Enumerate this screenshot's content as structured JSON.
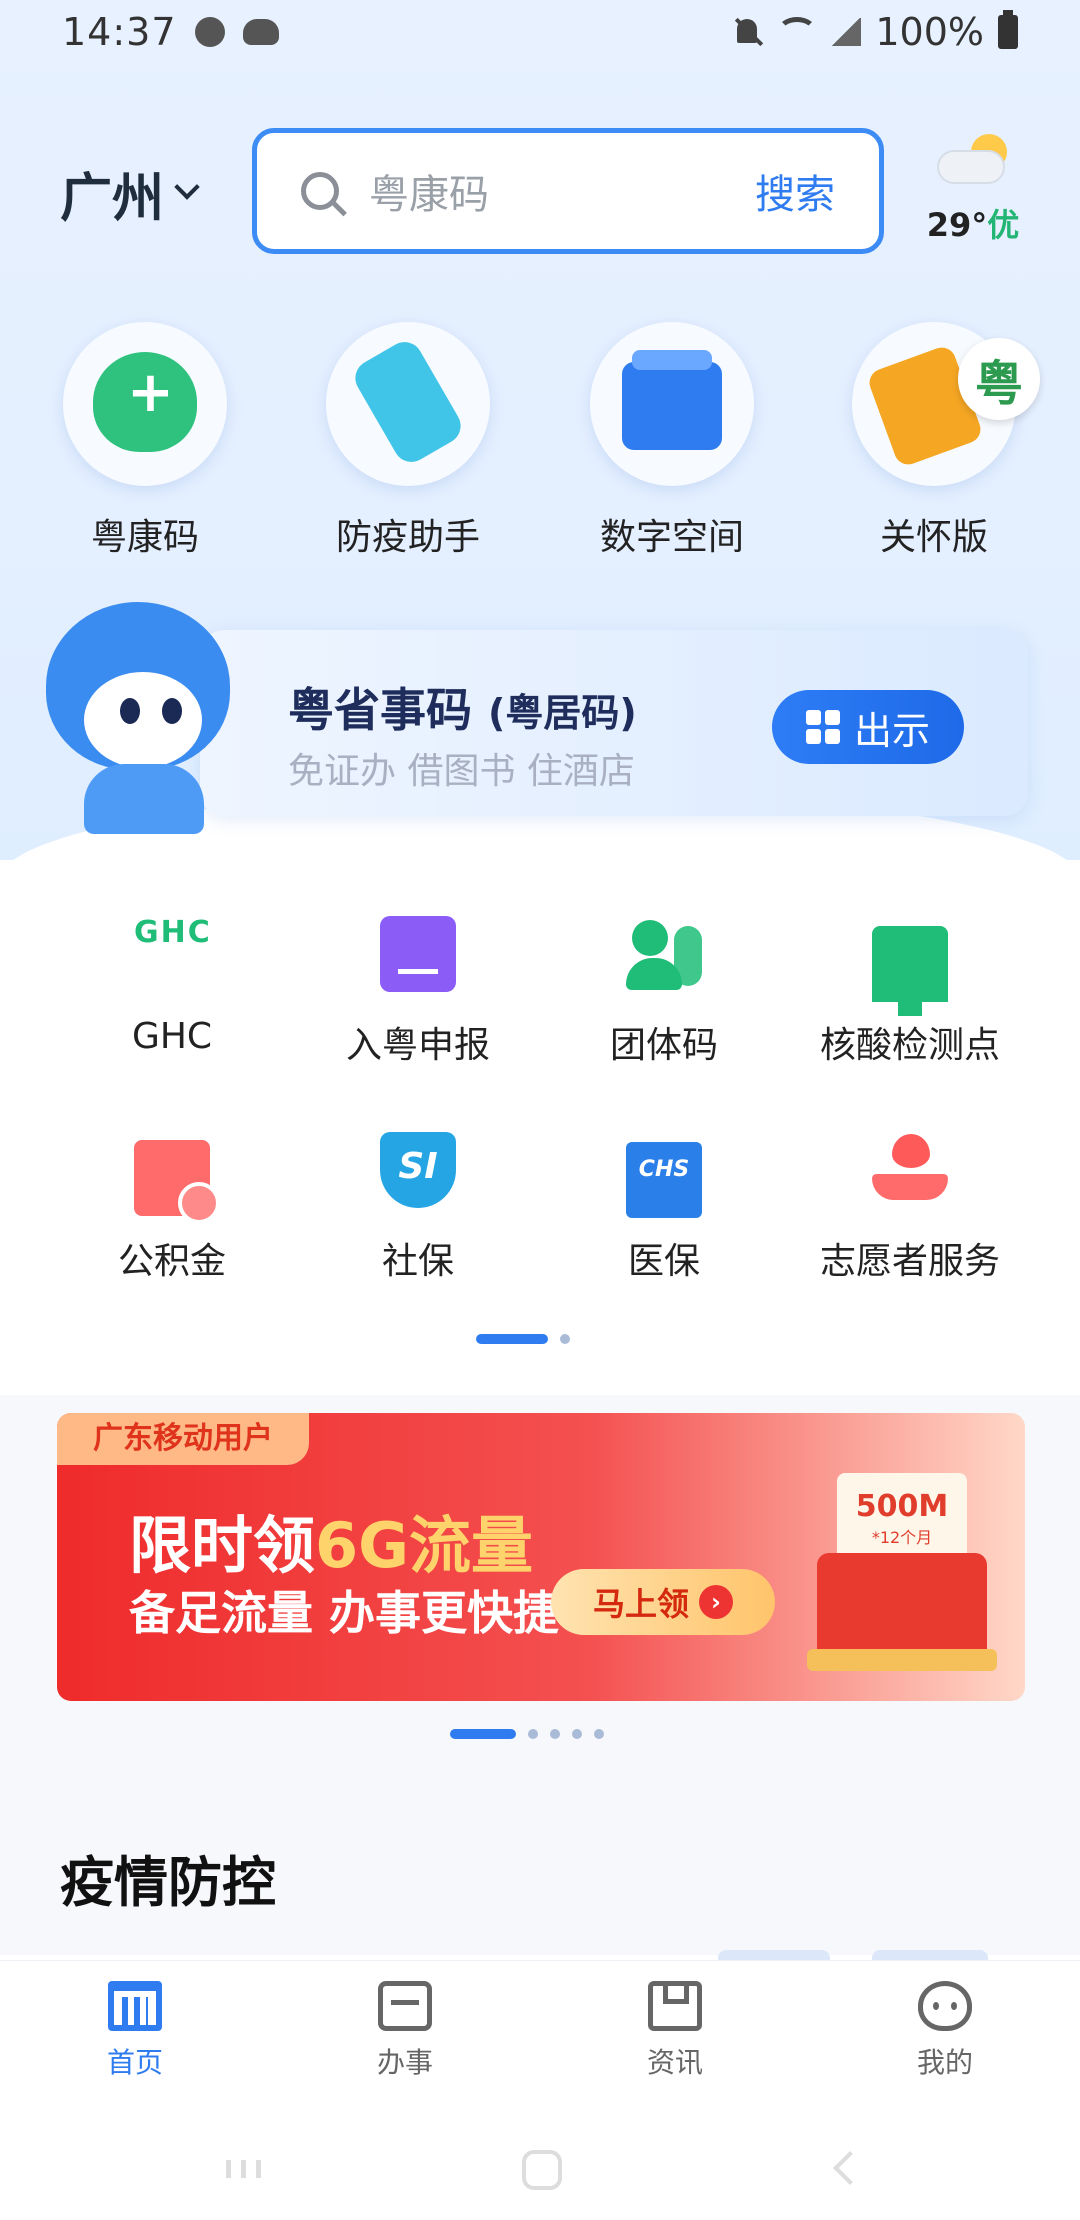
{
  "status_bar": {
    "time": "14:37",
    "battery": "100%",
    "icons": [
      "sync-icon",
      "cloud-icon",
      "mute-icon",
      "wifi-icon",
      "signal-icon",
      "battery-icon"
    ]
  },
  "header": {
    "city": "广州",
    "search_placeholder": "粤康码",
    "search_button": "搜索",
    "weather_temp": "29°",
    "weather_aqi": "优"
  },
  "top_apps": [
    {
      "label": "粤康码",
      "icon": "health-code-heart-icon"
    },
    {
      "label": "防疫助手",
      "icon": "epidemic-assistant-icon"
    },
    {
      "label": "数字空间",
      "icon": "digital-space-icon"
    },
    {
      "label": "关怀版",
      "icon": "care-mode-icon",
      "badge": "粤"
    }
  ],
  "card": {
    "title": "粤省事码",
    "title_suffix": "(粤居码)",
    "subtitle": "免证办 借图书 住酒店",
    "button": "出示"
  },
  "services": [
    {
      "label": "GHC",
      "icon": "ghc-icon",
      "icon_text": "GHC"
    },
    {
      "label": "入粤申报",
      "icon": "declaration-icon"
    },
    {
      "label": "团体码",
      "icon": "group-code-icon"
    },
    {
      "label": "核酸检测点",
      "icon": "testing-site-icon"
    },
    {
      "label": "公积金",
      "icon": "housing-fund-icon"
    },
    {
      "label": "社保",
      "icon": "social-security-icon",
      "icon_text": "SI"
    },
    {
      "label": "医保",
      "icon": "medical-insurance-icon",
      "icon_text": "CHS"
    },
    {
      "label": "志愿者服务",
      "icon": "volunteer-service-icon"
    }
  ],
  "banner": {
    "tag": "广东移动用户",
    "headline_prefix": "限时领",
    "headline_highlight": "6G流量",
    "subline": "备足流量 办事更快捷",
    "cta": "马上领",
    "envelope_amount": "500M",
    "envelope_note": "*12个月"
  },
  "section": {
    "title": "疫情防控"
  },
  "bottom_nav": [
    {
      "label": "首页",
      "icon": "home-icon",
      "active": true
    },
    {
      "label": "办事",
      "icon": "services-icon",
      "active": false
    },
    {
      "label": "资讯",
      "icon": "news-icon",
      "active": false
    },
    {
      "label": "我的",
      "icon": "profile-icon",
      "active": false
    }
  ],
  "colors": {
    "accent": "#2f7cf0",
    "green": "#1fbd77",
    "promo_red": "#ef2b2b"
  }
}
